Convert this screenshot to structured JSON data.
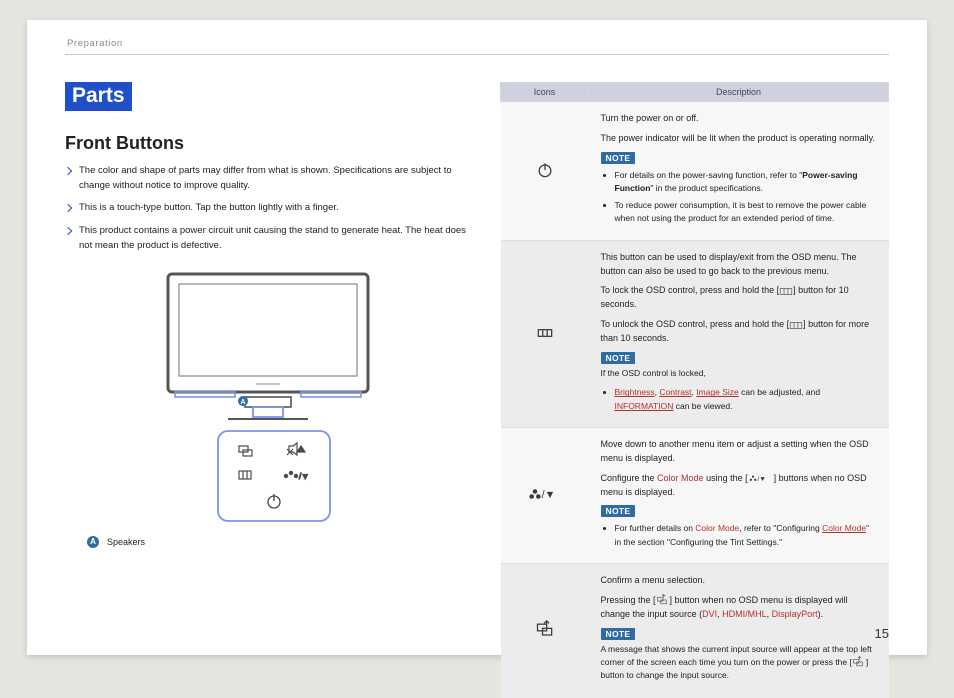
{
  "header": {
    "section": "Preparation",
    "page_number": "15"
  },
  "left": {
    "section_title": "Parts",
    "subsection_title": "Front Buttons",
    "bullets": [
      "The color and shape of parts may differ from what is shown. Specifications are subject to change without notice to improve quality.",
      "This is a touch-type button. Tap the button lightly with a finger.",
      "This product contains a power circuit unit causing the stand to generate heat. The heat does not mean the product is defective."
    ],
    "legend_marker": "A",
    "legend_label": "Speakers"
  },
  "table": {
    "head_icons": "Icons",
    "head_desc": "Description",
    "rows": [
      {
        "icon": "power",
        "p1": "Turn the power on or off.",
        "p2": "The power indicator will be lit when the product is operating normally.",
        "note": "NOTE",
        "items": [
          {
            "pre": "For details on the power-saving function, refer to \"",
            "bold": "Power-saving Function",
            "post": "\" in the product specifications."
          },
          {
            "text": "To reduce power consumption, it is best to remove the power cable when not using the product for an extended period of time."
          }
        ]
      },
      {
        "icon": "menu",
        "p1": "This button can be used to display/exit from the OSD menu. The button can also be used to go back to the previous menu.",
        "p2a": "To lock the OSD control, press and hold the [",
        "p2b": "] button for 10 seconds.",
        "p3a": "To unlock the OSD control, press and hold the [",
        "p3b": "] button for more than 10 seconds.",
        "note": "NOTE",
        "note_lead": "If the OSD control is locked,",
        "links": {
          "a": "Brightness",
          "b": "Contrast",
          "c": "Image Size",
          "mid": " can be adjusted, and ",
          "d": "INFORMATION",
          "tail": " can be viewed."
        }
      },
      {
        "icon": "mode-down",
        "p1": "Move down to another menu item or adjust a setting when the OSD menu is displayed.",
        "p2a": "Configure the ",
        "p2_link": "Color Mode",
        "p2b": " using the [",
        "p2c": "] buttons when no OSD menu is displayed.",
        "note": "NOTE",
        "item_pre": "For further details on ",
        "item_link1": "Color Mode",
        "item_mid": ", refer to \"Configuring ",
        "item_link2": "Color Mode",
        "item_post": "\" in the section \"Configuring the Tint Settings.\""
      },
      {
        "icon": "source",
        "p1": "Confirm a menu selection.",
        "p2a": "Pressing the [",
        "p2b": "] button when no OSD menu is displayed will change the input source (",
        "src1": "DVI",
        "sep1": ", ",
        "src2": "HDMI/MHL",
        "sep2": ", ",
        "src3": "DisplayPort",
        "p2c": ").",
        "note": "NOTE",
        "msg_a": "A message that shows the current input source will appear at the top left corner of the screen each time you turn on the power or press the [",
        "msg_b": "] button to change the input source."
      }
    ]
  }
}
